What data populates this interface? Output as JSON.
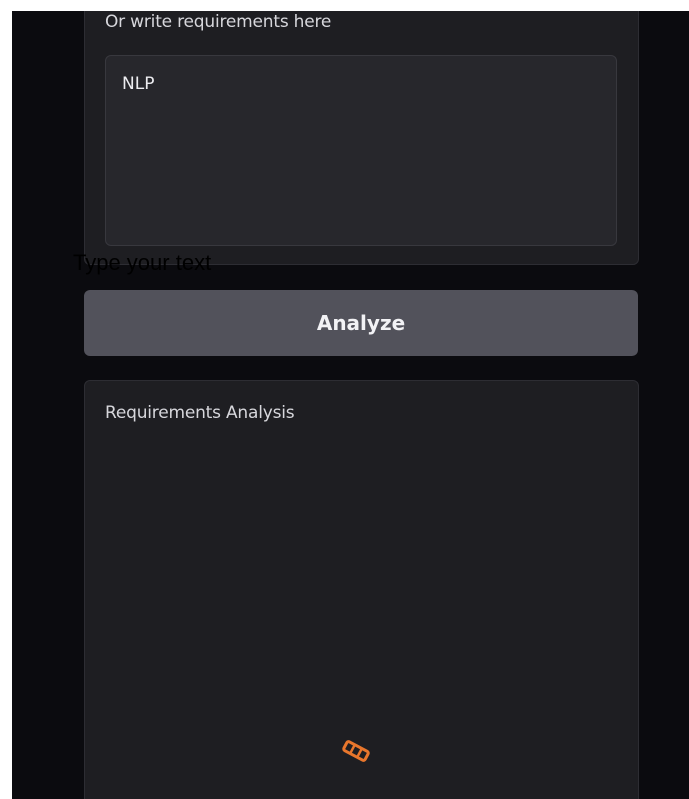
{
  "input_section": {
    "label": "Or write requirements here",
    "textarea_value": "NLP"
  },
  "overlay": {
    "left_fragment": "t",
    "placeholder_text": "Type your text"
  },
  "analyze_button": {
    "label": "Analyze"
  },
  "output_section": {
    "label": "Requirements Analysis",
    "loader_icon": "loading-spinner-icon",
    "loader_color": "#e8762c"
  },
  "colors": {
    "app_background": "#0b0b0f",
    "panel_background": "#1e1e22",
    "button_background": "#52525b"
  }
}
